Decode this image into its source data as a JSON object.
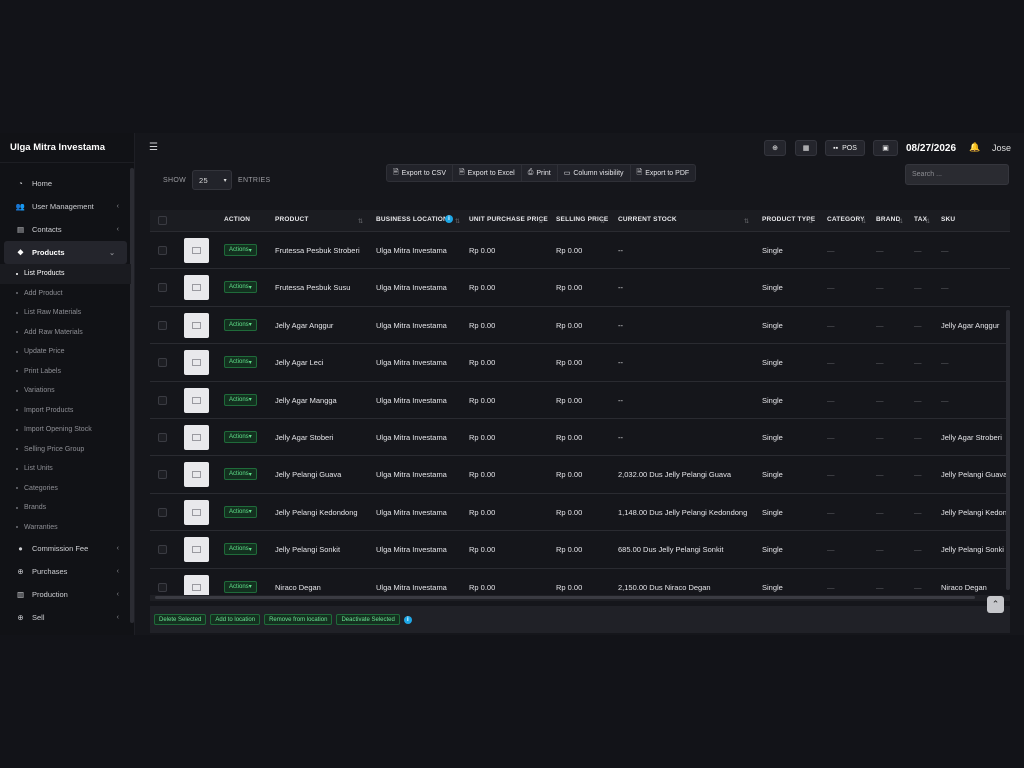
{
  "app": {
    "title": "Ulga Mitra Investama"
  },
  "sidebar": {
    "items": [
      {
        "label": "Home",
        "icon": "tachometer-icon",
        "chevron": false
      },
      {
        "label": "User Management",
        "icon": "users-icon",
        "chevron": true
      },
      {
        "label": "Contacts",
        "icon": "address-book-icon",
        "chevron": true
      },
      {
        "label": "Products",
        "icon": "cubes-icon",
        "chevron": true,
        "active": true
      }
    ],
    "subitems": [
      "List Products",
      "Add Product",
      "List Raw Materials",
      "Add Raw Materials",
      "Update Price",
      "Print Labels",
      "Variations",
      "Import Products",
      "Import Opening Stock",
      "Selling Price Group",
      "List Units",
      "Categories",
      "Brands",
      "Warranties"
    ],
    "items_after": [
      {
        "label": "Commission Fee",
        "icon": "percent-icon"
      },
      {
        "label": "Purchases",
        "icon": "arrow-circle-down-icon"
      },
      {
        "label": "Production",
        "icon": "industry-icon"
      },
      {
        "label": "Sell",
        "icon": "arrow-circle-up-icon"
      }
    ]
  },
  "topbar": {
    "pos_label": "POS",
    "date": "08/27/2026",
    "user": "Jose"
  },
  "controls": {
    "show_label": "SHOW",
    "entries_value": "25",
    "entries_label": "ENTRIES",
    "exports": [
      "Export to CSV",
      "Export to Excel",
      "Print",
      "Column visibility",
      "Export to PDF"
    ],
    "search_placeholder": "Search ..."
  },
  "table": {
    "headers": {
      "action": "ACTION",
      "product": "PRODUCT",
      "location": "BUSINESS LOCATION",
      "unit_price": "UNIT PURCHASE PRICE",
      "selling": "SELLING PRICE",
      "stock": "CURRENT STOCK",
      "type": "PRODUCT TYPE",
      "category": "CATEGORY",
      "brand": "BRAND",
      "tax": "TAX",
      "sku": "SKU"
    },
    "action_label": "Actions",
    "dash": "—",
    "rows": [
      {
        "product": "Frutessa Pesbuk Stroberi",
        "location": "Ulga Mitra Investama",
        "unit_price": "Rp 0.00",
        "selling": "Rp 0.00",
        "stock": "--",
        "type": "Single",
        "sku": "—"
      },
      {
        "product": "Frutessa Pesbuk Susu",
        "location": "Ulga Mitra Investama",
        "unit_price": "Rp 0.00",
        "selling": "Rp 0.00",
        "stock": "--",
        "type": "Single",
        "sku": "—"
      },
      {
        "product": "Jelly Agar Anggur",
        "location": "Ulga Mitra Investama",
        "unit_price": "Rp 0.00",
        "selling": "Rp 0.00",
        "stock": "--",
        "type": "Single",
        "sku": "Jelly Agar Anggur"
      },
      {
        "product": "Jelly Agar Leci",
        "location": "Ulga Mitra Investama",
        "unit_price": "Rp 0.00",
        "selling": "Rp 0.00",
        "stock": "--",
        "type": "Single",
        "sku": "—"
      },
      {
        "product": "Jelly Agar Mangga",
        "location": "Ulga Mitra Investama",
        "unit_price": "Rp 0.00",
        "selling": "Rp 0.00",
        "stock": "--",
        "type": "Single",
        "sku": "—"
      },
      {
        "product": "Jelly Agar Stoberi",
        "location": "Ulga Mitra Investama",
        "unit_price": "Rp 0.00",
        "selling": "Rp 0.00",
        "stock": "--",
        "type": "Single",
        "sku": "Jelly Agar Stroberi"
      },
      {
        "product": "Jelly Pelangi Guava",
        "location": "Ulga Mitra Investama",
        "unit_price": "Rp 0.00",
        "selling": "Rp 0.00",
        "stock": "2,032.00 Dus Jelly Pelangi Guava",
        "type": "Single",
        "sku": "Jelly Pelangi Guava"
      },
      {
        "product": "Jelly Pelangi Kedondong",
        "location": "Ulga Mitra Investama",
        "unit_price": "Rp 0.00",
        "selling": "Rp 0.00",
        "stock": "1,148.00 Dus Jelly Pelangi Kedondong",
        "type": "Single",
        "sku": "Jelly Pelangi Kedon"
      },
      {
        "product": "Jelly Pelangi Sonkit",
        "location": "Ulga Mitra Investama",
        "unit_price": "Rp 0.00",
        "selling": "Rp 0.00",
        "stock": "685.00 Dus Jelly Pelangi Sonkit",
        "type": "Single",
        "sku": "Jelly Pelangi Sonki"
      },
      {
        "product": "Niraco Degan",
        "location": "Ulga Mitra Investama",
        "unit_price": "Rp 0.00",
        "selling": "Rp 0.00",
        "stock": "2,150.00 Dus Niraco Degan",
        "type": "Single",
        "sku": "Niraco Degan"
      }
    ]
  },
  "bulk": [
    "Delete Selected",
    "Add to location",
    "Remove from location",
    "Deactivate Selected"
  ],
  "colors": {
    "accent_green": "#5fe08a",
    "info_blue": "#1ea7e6",
    "bg": "#15161b"
  }
}
